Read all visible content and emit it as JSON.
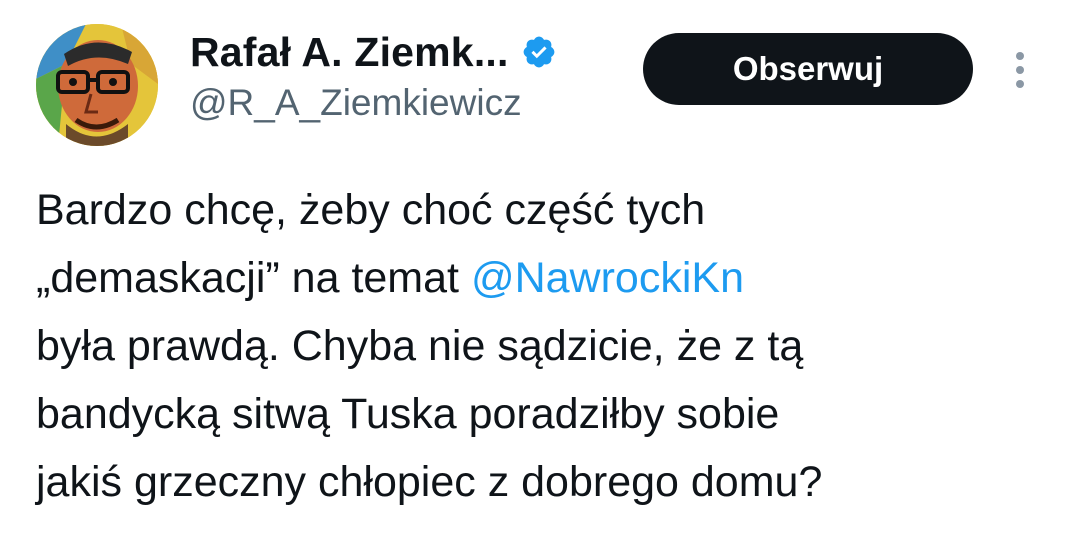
{
  "author": {
    "name": "Rafał A. Ziemk...",
    "handle": "@R_A_Ziemkiewicz",
    "verified": true
  },
  "follow_button": {
    "label": "Obserwuj"
  },
  "more_menu": {
    "icon": "more-vertical-icon"
  },
  "tweet": {
    "line1": "Bardzo chcę, żeby choć część tych",
    "line2_before": "„demaskacji” na temat ",
    "mention": "@NawrockiKn",
    "line3": "była prawdą. Chyba nie sądzicie, że z tą",
    "line4": "bandycką sitwą Tuska poradziłby sobie",
    "line5": "jakiś grzeczny chłopiec z dobrego domu?"
  },
  "colors": {
    "text": "#0f1419",
    "secondary": "#536471",
    "link": "#1d9bf0",
    "button_bg": "#0f1419",
    "verified": "#1d9bf0"
  }
}
